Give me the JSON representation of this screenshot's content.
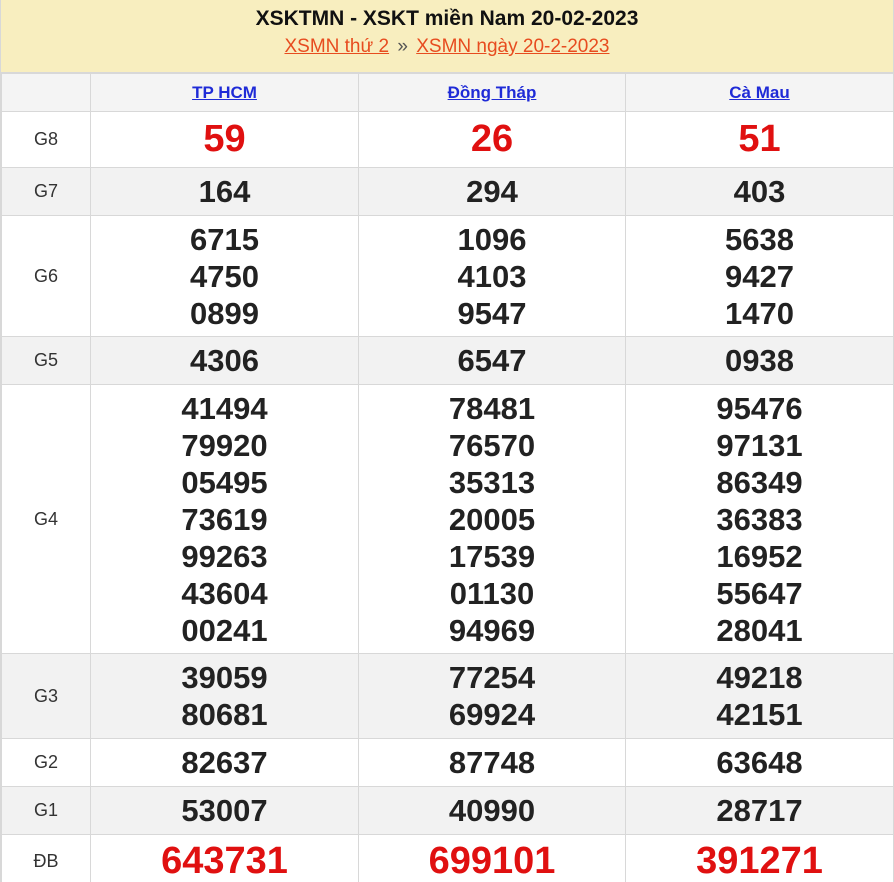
{
  "header": {
    "title": "XSKTMN - XSKT miền Nam 20-02-2023",
    "crumb1": "XSMN thứ 2",
    "sep": "»",
    "crumb2": "XSMN ngày 20-2-2023"
  },
  "columns": [
    "TP HCM",
    "Đồng Tháp",
    "Cà Mau"
  ],
  "rows": [
    {
      "label": "G8",
      "values": [
        [
          "59"
        ],
        [
          "26"
        ],
        [
          "51"
        ]
      ]
    },
    {
      "label": "G7",
      "values": [
        [
          "164"
        ],
        [
          "294"
        ],
        [
          "403"
        ]
      ]
    },
    {
      "label": "G6",
      "values": [
        [
          "6715",
          "4750",
          "0899"
        ],
        [
          "1096",
          "4103",
          "9547"
        ],
        [
          "5638",
          "9427",
          "1470"
        ]
      ]
    },
    {
      "label": "G5",
      "values": [
        [
          "4306"
        ],
        [
          "6547"
        ],
        [
          "0938"
        ]
      ]
    },
    {
      "label": "G4",
      "values": [
        [
          "41494",
          "79920",
          "05495",
          "73619",
          "99263",
          "43604",
          "00241"
        ],
        [
          "78481",
          "76570",
          "35313",
          "20005",
          "17539",
          "01130",
          "94969"
        ],
        [
          "95476",
          "97131",
          "86349",
          "36383",
          "16952",
          "55647",
          "28041"
        ]
      ]
    },
    {
      "label": "G3",
      "values": [
        [
          "39059",
          "80681"
        ],
        [
          "77254",
          "69924"
        ],
        [
          "49218",
          "42151"
        ]
      ]
    },
    {
      "label": "G2",
      "values": [
        [
          "82637"
        ],
        [
          "87748"
        ],
        [
          "63648"
        ]
      ]
    },
    {
      "label": "G1",
      "values": [
        [
          "53007"
        ],
        [
          "40990"
        ],
        [
          "28717"
        ]
      ]
    },
    {
      "label": "ĐB",
      "values": [
        [
          "643731"
        ],
        [
          "699101"
        ],
        [
          "391271"
        ]
      ]
    }
  ]
}
